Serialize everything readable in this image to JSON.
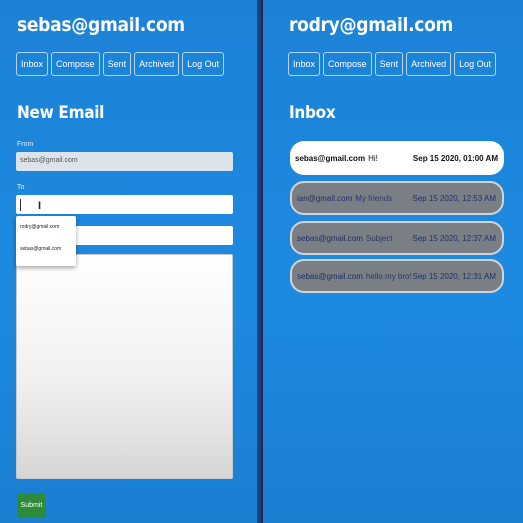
{
  "left": {
    "user": "sebas@gmail.com",
    "nav": [
      "Inbox",
      "Compose",
      "Sent",
      "Archived",
      "Log Out"
    ],
    "title": "New Email",
    "from_label": "From",
    "from_value": "sebas@gmail.com",
    "to_label": "To",
    "to_value": "",
    "subject_value": "",
    "body_value": "",
    "autocomplete": [
      "rodry@gmail.com",
      "sebas@gmail.com"
    ],
    "submit_label": "Submit"
  },
  "right": {
    "user": "rodry@gmail.com",
    "nav": [
      "Inbox",
      "Compose",
      "Sent",
      "Archived",
      "Log Out"
    ],
    "title": "Inbox",
    "emails": [
      {
        "sender": "sebas@gmail.com",
        "subject": "Hi!",
        "date": "Sep 15 2020, 01:00 AM",
        "read": false
      },
      {
        "sender": "ian@gmail.com",
        "subject": "My friends",
        "date": "Sep 15 2020, 12:53 AM",
        "read": true
      },
      {
        "sender": "sebas@gmail.com",
        "subject": "Subject",
        "date": "Sep 15 2020, 12:37 AM",
        "read": true
      },
      {
        "sender": "sebas@gmail.com",
        "subject": "hello my bro!",
        "date": "Sep 15 2020, 12:31 AM",
        "read": true
      }
    ]
  },
  "colors": {
    "background": "#1e86d9",
    "submit": "#2e8b3a",
    "read_email": "#7a7f85",
    "unread_email": "#ffffff"
  }
}
